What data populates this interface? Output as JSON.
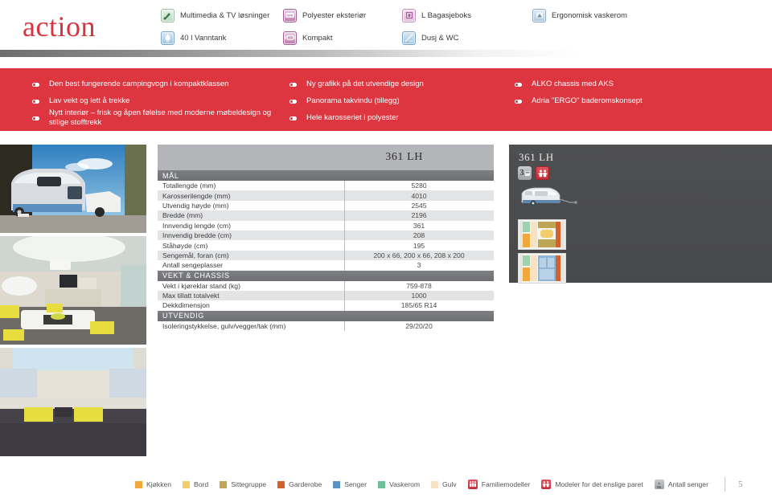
{
  "brand": {
    "name": "action"
  },
  "header_features": [
    {
      "label": "Multimedia & TV løsninger",
      "icon": "multimedia-icon",
      "color": "#bcd9c2"
    },
    {
      "label": "Polyester eksteriør",
      "icon": "gfk-polyester-icon",
      "color": "#b878ab"
    },
    {
      "label": "L Bagasjeboks",
      "icon": "luggage-box-icon",
      "color": "#e2c2dc"
    },
    {
      "label": "Ergonomisk vaskerom",
      "icon": "washroom-icon",
      "color": "#aec7db"
    },
    {
      "label": "40 l Vanntank",
      "icon": "water-tank-icon",
      "color": "#9dc0de"
    },
    {
      "label": "Kompakt",
      "icon": "compact-caravan-icon",
      "color": "#b878ab"
    },
    {
      "label": "Dusj & WC",
      "icon": "shower-wc-icon",
      "color": "#9dc0de"
    }
  ],
  "highlights": [
    "Den best fungerende campingvogn i kompaktklassen",
    "Ny grafikk på det utvendige design",
    "ALKO chassis med AKS",
    "Lav vekt og lett å trekke",
    "Panorama takvindu (tillegg)",
    "Adria \"ERGO\" baderomskonsept",
    "Nytt interiør – frisk og åpen følelse med moderne møbeldesign og stilige stofftrekk",
    "Hele karosseriet i polyester"
  ],
  "photos": [
    {
      "caption": "exterior-caravan-photo"
    },
    {
      "caption": "interior-lounge-photo"
    },
    {
      "caption": "interior-bedroom-photo"
    }
  ],
  "spec_table": {
    "model": "361 LH",
    "sections": [
      {
        "title": "MÅL",
        "rows": [
          {
            "key": "Totallengde (mm)",
            "value": "5280"
          },
          {
            "key": "Karosserilengde (mm)",
            "value": "4010"
          },
          {
            "key": "Utvendig høyde (mm)",
            "value": "2545"
          },
          {
            "key": "Bredde (mm)",
            "value": "2196"
          },
          {
            "key": "Innvendig lengde (cm)",
            "value": "361"
          },
          {
            "key": "Innvendig bredde (cm)",
            "value": "208"
          },
          {
            "key": "Ståhøyde (cm)",
            "value": "195"
          },
          {
            "key": "Sengemål, foran (cm)",
            "value": "200 x 66, 200 x 66, 208 x 200"
          },
          {
            "key": "Antall sengeplasser",
            "value": "3"
          }
        ]
      },
      {
        "title": "VEKT & CHASSIS",
        "rows": [
          {
            "key": "Vekt i kjøreklar stand (kg)",
            "value": "759-878"
          },
          {
            "key": "Max tillatt totalvekt",
            "value": "1000"
          },
          {
            "key": "Dekkdimensjon",
            "value": "185/65 R14"
          }
        ]
      },
      {
        "title": "UTVENDIG",
        "rows": [
          {
            "key": "Isoleringstykkelse, gulv/vegger/tak (mm)",
            "value": "29/20/20"
          }
        ]
      }
    ]
  },
  "plan_panel": {
    "model": "361 LH",
    "badge_beds": "3",
    "badge_beds_name": "bed-count-badge",
    "badge_couple_name": "couple-model-badge",
    "caravan_icon": "caravan-silhouette-icon",
    "floorplan_day": "floorplan-day-layout",
    "floorplan_night": "floorplan-night-layout"
  },
  "legend": {
    "items": [
      {
        "label": "Kjøkken",
        "color": "#f0a83c"
      },
      {
        "label": "Bord",
        "color": "#f2cd6b"
      },
      {
        "label": "Sittegruppe",
        "color": "#bda757"
      },
      {
        "label": "Garderobe",
        "color": "#d2622e"
      },
      {
        "label": "Senger",
        "color": "#5d93c4"
      },
      {
        "label": "Vaskerom",
        "color": "#6fbf9a"
      },
      {
        "label": "Gulv",
        "color": "#f7e2c4"
      }
    ],
    "icon_items": [
      {
        "label": "Familiemodeller",
        "icon": "family-models-icon",
        "style": "red"
      },
      {
        "label": "Modeler for det enslige paret",
        "icon": "couple-models-icon",
        "style": "red"
      },
      {
        "label": "Antall senger",
        "icon": "bed-count-icon",
        "style": "gray"
      }
    ],
    "page_number": "5"
  },
  "colors": {
    "brand_red": "#d8333f",
    "band_red": "#dd3640",
    "panel_gray": "#4e4f51",
    "table_header_gray": "#b3b5b8",
    "section_gray": "#7d7f82",
    "row_alt": "#e3e4e6"
  }
}
